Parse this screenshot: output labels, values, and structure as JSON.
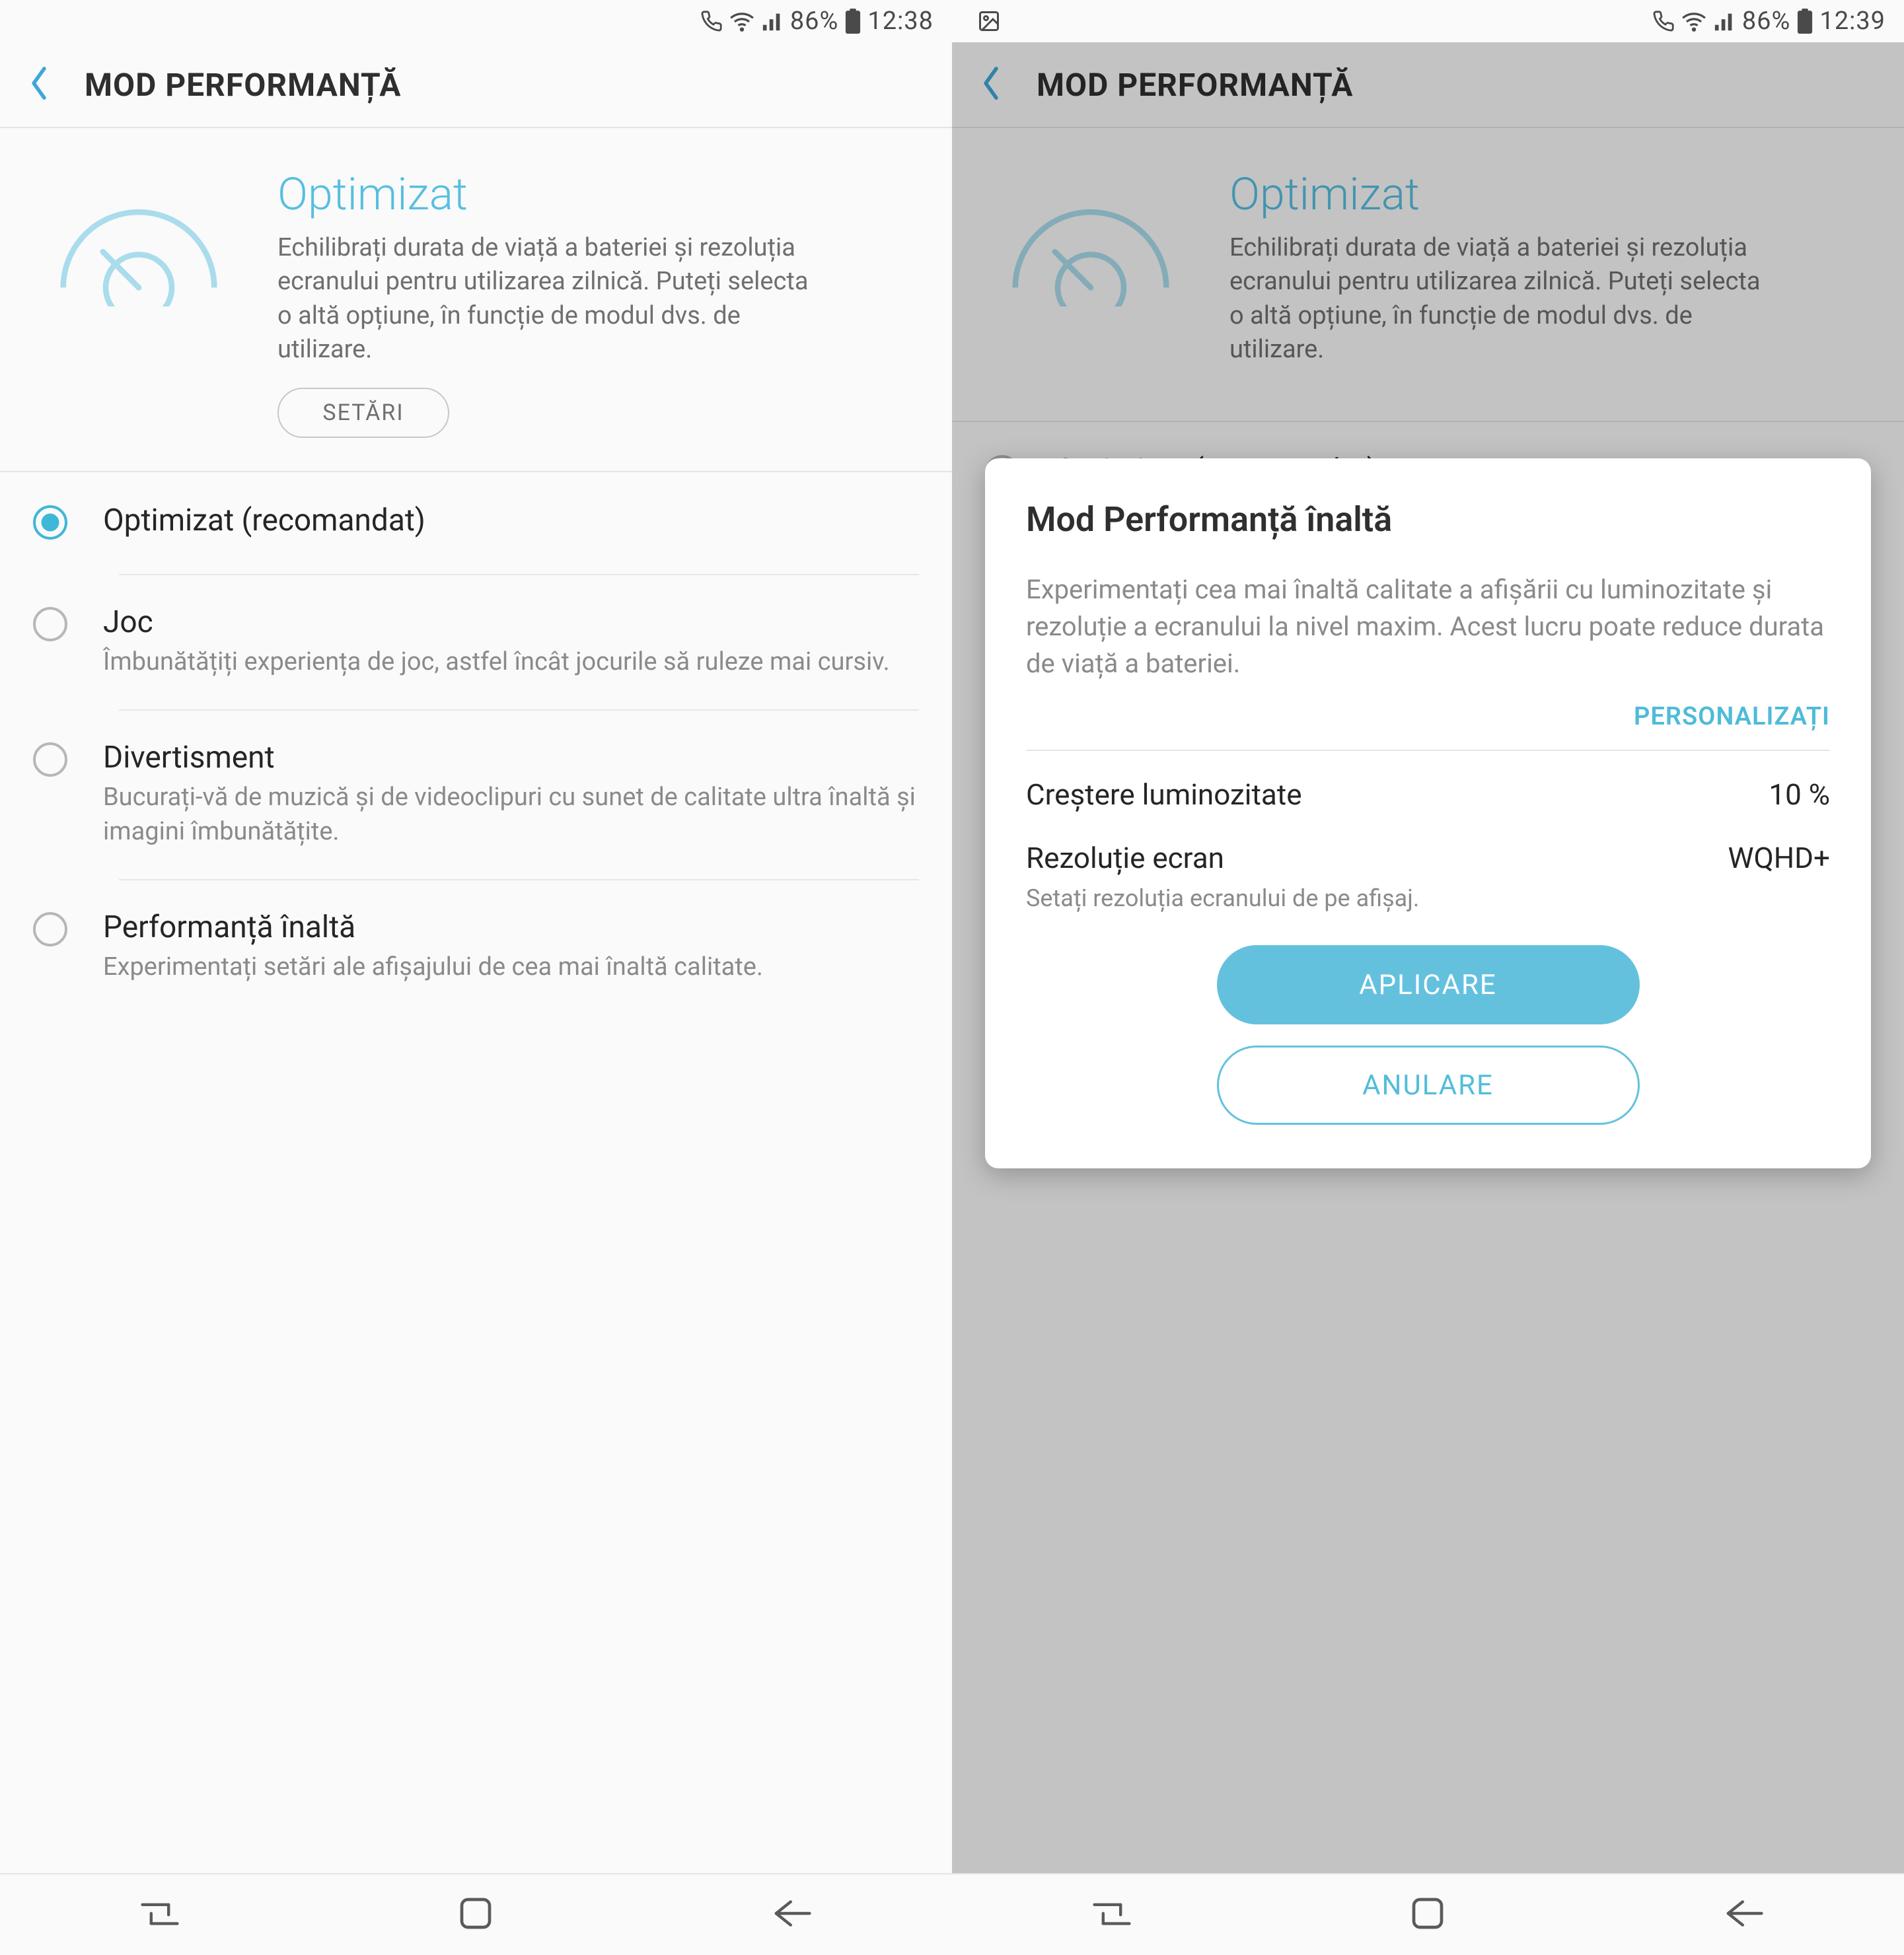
{
  "left": {
    "status": {
      "battery_pct": "86%",
      "time": "12:38"
    },
    "header": {
      "title": "MOD PERFORMANȚĂ"
    },
    "hero": {
      "title": "Optimizat",
      "desc": "Echilibrați durata de viață a bateriei și rezoluția ecranului pentru utilizarea zilnică. Puteți selecta o altă opțiune, în funcție de modul dvs. de utilizare.",
      "settings_btn": "SETĂRI"
    },
    "options": [
      {
        "title": "Optimizat (recomandat)",
        "desc": "",
        "checked": true
      },
      {
        "title": "Joc",
        "desc": "Îmbunătățiți experiența de joc, astfel încât jocurile să ruleze mai cursiv.",
        "checked": false
      },
      {
        "title": "Divertisment",
        "desc": "Bucurați-vă de muzică și de videoclipuri cu sunet de calitate ultra înaltă și imagini îmbunătățite.",
        "checked": false
      },
      {
        "title": "Performanță înaltă",
        "desc": "Experimentați setări ale afișajului de cea mai înaltă calitate.",
        "checked": false
      }
    ]
  },
  "right": {
    "status": {
      "battery_pct": "86%",
      "time": "12:39"
    },
    "header": {
      "title": "MOD PERFORMANȚĂ"
    },
    "hero": {
      "title": "Optimizat",
      "desc": "Echilibrați durata de viață a bateriei și rezoluția ecranului pentru utilizarea zilnică. Puteți selecta o altă opțiune, în funcție de modul dvs. de utilizare."
    },
    "dialog": {
      "title": "Mod Performanță înaltă",
      "desc": "Experimentați cea mai înaltă calitate a afișării cu luminozitate și rezoluție a ecranului la nivel maxim. Acest lucru poate reduce durata de viață a bateriei.",
      "customize": "PERSONALIZAȚI",
      "brightness_label": "Creștere luminozitate",
      "brightness_value": "10 %",
      "resolution_label": "Rezoluție ecran",
      "resolution_value": "WQHD+",
      "resolution_sub": "Setați rezoluția ecranului de pe afișaj.",
      "apply": "APLICARE",
      "cancel": "ANULARE"
    }
  }
}
